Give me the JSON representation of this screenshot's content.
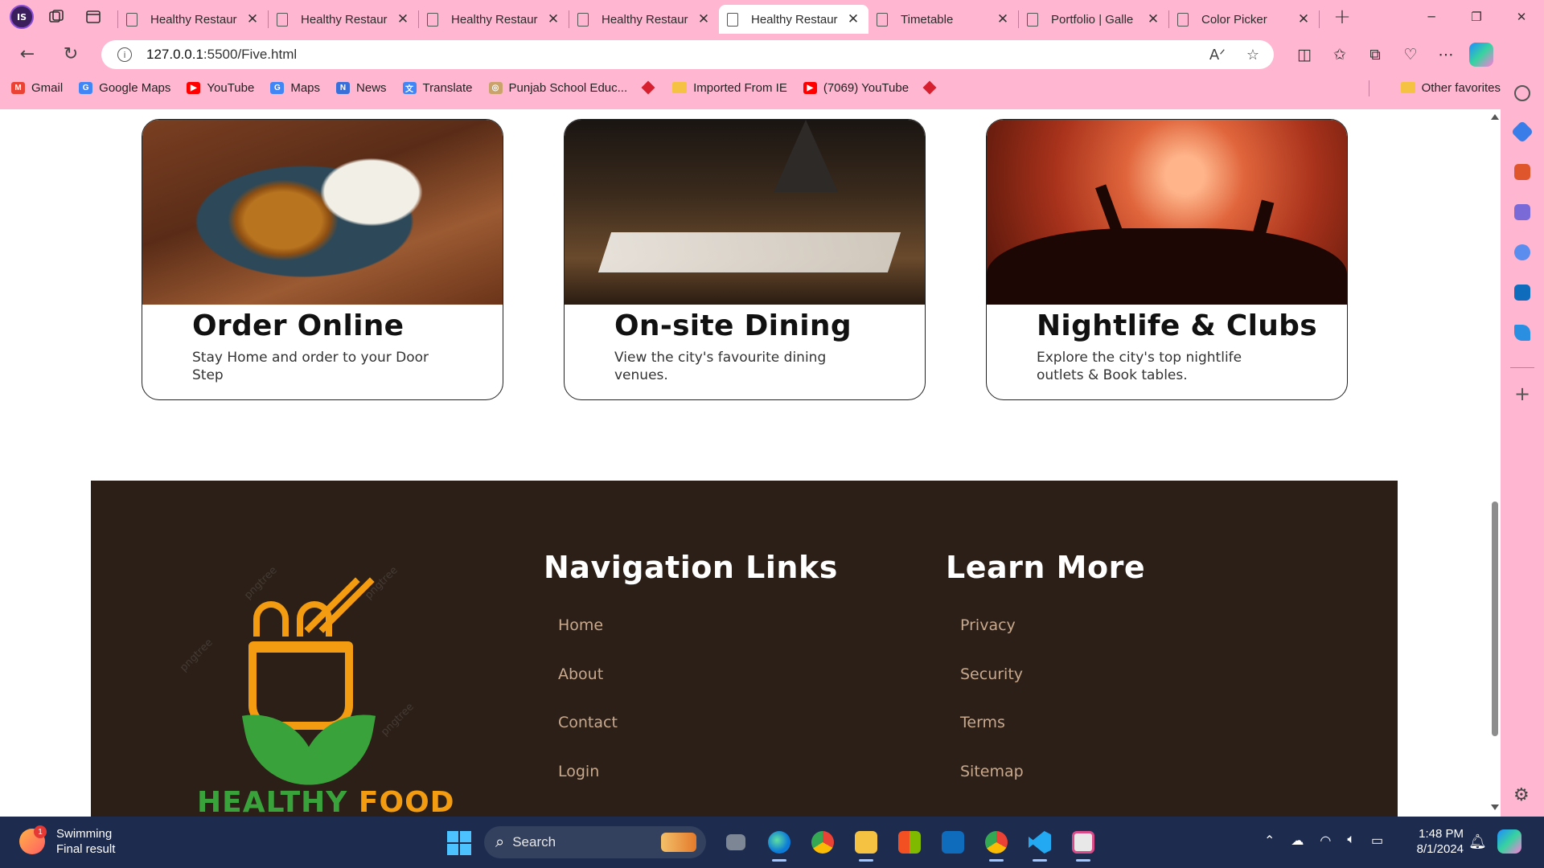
{
  "browser": {
    "profile_initials": "IS",
    "tabs": [
      {
        "title": "Healthy Restaur",
        "active": false
      },
      {
        "title": "Healthy Restaur",
        "active": false
      },
      {
        "title": "Healthy Restaur",
        "active": false
      },
      {
        "title": "Healthy Restaur",
        "active": false
      },
      {
        "title": "Healthy Restaur",
        "active": true
      },
      {
        "title": "Timetable",
        "active": false
      },
      {
        "title": "Portfolio | Galle",
        "active": false
      },
      {
        "title": "Color Picker",
        "active": false
      }
    ],
    "url_host": "127.0.0.1",
    "url_rest": ":5500/Five.html",
    "favorites": [
      {
        "label": "Gmail",
        "icon": "gmail-icon"
      },
      {
        "label": "Google Maps",
        "icon": "google-icon"
      },
      {
        "label": "YouTube",
        "icon": "youtube-icon"
      },
      {
        "label": "Maps",
        "icon": "google-icon"
      },
      {
        "label": "News",
        "icon": "news-icon"
      },
      {
        "label": "Translate",
        "icon": "translate-icon"
      },
      {
        "label": "Punjab School Educ...",
        "icon": "school-icon"
      },
      {
        "label": "Imported From IE",
        "icon": "folder-icon"
      },
      {
        "label": "(7069) YouTube",
        "icon": "youtube-icon"
      }
    ],
    "other_favorites": "Other favorites"
  },
  "cards": [
    {
      "title": "Order Online",
      "description": "Stay Home and order to your Door Step"
    },
    {
      "title": "On-site Dining",
      "description": "View the city's favourite dining venues."
    },
    {
      "title": "Nightlife & Clubs",
      "description": "Explore the city's top nightlife outlets & Book tables."
    }
  ],
  "footer": {
    "logo_brand_green": "HEALTHY",
    "logo_brand_orange": "FOOD",
    "watermark": "pngtree",
    "nav_heading": "Navigation Links",
    "nav_links": [
      "Home",
      "About",
      "Contact",
      "Login"
    ],
    "learn_heading": "Learn More",
    "learn_links": [
      "Privacy",
      "Security",
      "Terms",
      "Sitemap"
    ]
  },
  "taskbar": {
    "weather_title": "Swimming",
    "weather_sub": "Final result",
    "weather_badge": "1",
    "search_label": "Search",
    "time": "1:48 PM",
    "date": "8/1/2024"
  },
  "colors": {
    "browser_chrome": "#ffb6d1",
    "footer_bg": "#2b1f18",
    "footer_link": "#c9a98d",
    "logo_green": "#3aa23a",
    "logo_orange": "#f39c12"
  }
}
